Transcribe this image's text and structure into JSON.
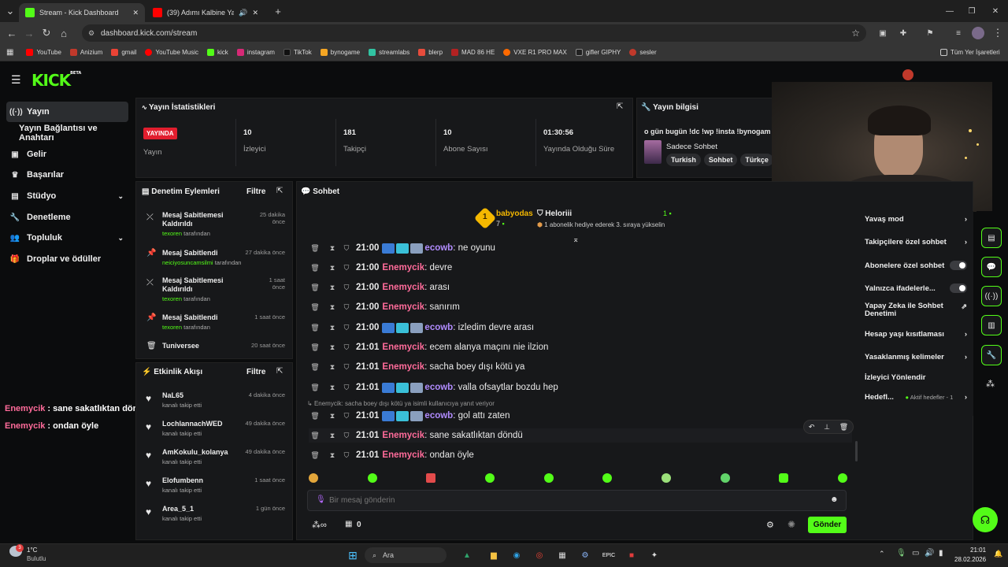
{
  "browser": {
    "tabs": [
      {
        "title": "Stream - Kick Dashboard",
        "active": true
      },
      {
        "title": "(39) Adımı Kalbine Yaz - You",
        "active": false
      }
    ],
    "url": "dashboard.kick.com/stream",
    "bookmarks": [
      "YouTube",
      "Anizium",
      "gmail",
      "YouTube Music",
      "kick",
      "instagram",
      "TikTok",
      "bynogame",
      "streamlabs",
      "blerp",
      "MAD 86 HE",
      "VXE R1 PRO MAX",
      "gifler GIPHY",
      "sesler"
    ],
    "all_bookmarks": "Tüm Yer İşaretleri"
  },
  "kick": {
    "logo": "KICK",
    "logo_sup": "BETA"
  },
  "sidebar": {
    "items": [
      {
        "label": "Yayın",
        "icon": "broadcast-icon",
        "active": true
      },
      {
        "label": "Yayın Bağlantısı ve Anahtarı",
        "icon": "",
        "active": false
      },
      {
        "label": "Gelir",
        "icon": "money-icon",
        "active": false
      },
      {
        "label": "Başarılar",
        "icon": "trophy-icon",
        "active": false
      },
      {
        "label": "Stüdyo",
        "icon": "studio-icon",
        "active": false
      },
      {
        "label": "Denetleme",
        "icon": "wrench-icon",
        "active": false
      },
      {
        "label": "Topluluk",
        "icon": "people-icon",
        "active": false
      },
      {
        "label": "Droplar ve ödüller",
        "icon": "gift-icon",
        "active": false
      }
    ]
  },
  "overlay_chat": [
    {
      "user": "Enemycik",
      "text": " : sane sakatlıktan döndü"
    },
    {
      "user": "Enemycik",
      "text": " : ondan öyle"
    }
  ],
  "stats": {
    "title": "Yayın İstatistikleri",
    "live_badge": "YAYINDA",
    "items": [
      {
        "value": "",
        "label": "Yayın"
      },
      {
        "value": "10",
        "label": "İzleyici"
      },
      {
        "value": "181",
        "label": "Takipçi"
      },
      {
        "value": "10",
        "label": "Abone Sayısı"
      },
      {
        "value": "01:30:56",
        "label": "Yayında Olduğu Süre"
      }
    ]
  },
  "stream_info": {
    "title": "Yayın bilgisi",
    "stream_title": "o gün bugün !dc !wp !insta !bynogam",
    "category": "Sadece Sohbet",
    "tags": [
      "Turkish",
      "Sohbet",
      "Türkçe"
    ]
  },
  "mod_actions": {
    "title": "Denetim Eylemleri",
    "filter": "Filtre",
    "by_suffix": "tarafından",
    "items": [
      {
        "action": "Mesaj Sabitlemesi Kaldırıldı",
        "by": "texoren",
        "time": "25 dakika önce",
        "icon": "unpin-icon"
      },
      {
        "action": "Mesaj Sabitlendi",
        "by": "neiciyosuncamsilmi",
        "time": "27 dakika önce",
        "icon": "pin-icon"
      },
      {
        "action": "Mesaj Sabitlemesi Kaldırıldı",
        "by": "texoren",
        "time": "1 saat önce",
        "icon": "unpin-icon"
      },
      {
        "action": "Mesaj Sabitlendi",
        "by": "texoren",
        "time": "1 saat önce",
        "icon": "pin-icon"
      },
      {
        "action": "Tuniversee",
        "by": "",
        "time": "20 saat önce",
        "icon": "trash-icon"
      }
    ]
  },
  "activity": {
    "title": "Etkinlik Akışı",
    "filter": "Filtre",
    "items": [
      {
        "name": "NaL65",
        "desc": "kanalı takip etti",
        "time": "4 dakika önce"
      },
      {
        "name": "LochlannachWED",
        "desc": "kanalı takip etti",
        "time": "49 dakika önce"
      },
      {
        "name": "AmKokulu_kolanya",
        "desc": "kanalı takip etti",
        "time": "49 dakika önce"
      },
      {
        "name": "Elofumbenn",
        "desc": "kanalı takip etti",
        "time": "1 saat önce"
      },
      {
        "name": "Area_5_1",
        "desc": "kanalı takip etti",
        "time": "1 gün önce"
      }
    ]
  },
  "chat": {
    "title": "Sohbet",
    "top_gifter": {
      "name": "babyodas",
      "rank": "1",
      "count": "7"
    },
    "sub_user": {
      "name": "Heloriii",
      "count": "1",
      "desc": "1 abonelik hediye ederek 3. sıraya yükselin"
    },
    "messages": [
      {
        "time": "21:00",
        "user": "ecowb",
        "text": "ne oyunu",
        "badges": true
      },
      {
        "time": "21:00",
        "user": "Enemycik",
        "text": "devre",
        "badges": false
      },
      {
        "time": "21:00",
        "user": "Enemycik",
        "text": "arası",
        "badges": false
      },
      {
        "time": "21:00",
        "user": "Enemycik",
        "text": "sanırım",
        "badges": false
      },
      {
        "time": "21:00",
        "user": "ecowb",
        "text": "izledim devre arası",
        "badges": true
      },
      {
        "time": "21:01",
        "user": "Enemycik",
        "text": "ecem alanya maçını nie ilzion",
        "badges": false
      },
      {
        "time": "21:01",
        "user": "Enemycik",
        "text": "sacha boey dışı kötü ya",
        "badges": false
      },
      {
        "time": "21:01",
        "user": "ecowb",
        "text": "valla ofsaytlar bozdu hep",
        "badges": true
      },
      {
        "time": "21:01",
        "user": "ecowb",
        "text": "gol attı zaten",
        "badges": true
      },
      {
        "time": "21:01",
        "user": "Enemycik",
        "text": "sane sakatlıktan döndü",
        "badges": false
      },
      {
        "time": "21:01",
        "user": "Enemycik",
        "text": "ondan öyle",
        "badges": false
      }
    ],
    "reply_note": "Enemycik: sacha boey dışı kötü ya isimli kullanıcıya yanıt veriyor",
    "input_placeholder": "Bir mesaj gönderin",
    "points": "0",
    "send": "Gönder"
  },
  "chat_settings": [
    {
      "label": "Yavaş mod",
      "type": "arrow"
    },
    {
      "label": "Takipçilere özel sohbet",
      "type": "arrow"
    },
    {
      "label": "Abonelere özel sohbet",
      "type": "toggle"
    },
    {
      "label": "Yalnızca ifadelerle...",
      "type": "toggle"
    },
    {
      "label": "Yapay Zeka ile Sohbet Denetimi",
      "type": "external"
    },
    {
      "label": "Hesap yaşı kısıtlaması",
      "type": "arrow"
    },
    {
      "label": "Yasaklanmış kelimeler",
      "type": "arrow"
    },
    {
      "label": "İzleyici Yönlendir",
      "type": "none"
    },
    {
      "label": "Hedefl...",
      "type": "arrow",
      "extra": "Aktif hedefler - 1"
    }
  ],
  "taskbar": {
    "weather_temp": "1°C",
    "weather_desc": "Bulutlu",
    "search": "Ara",
    "time": "21:01",
    "date": "28.02.2026",
    "weather_badge": "3"
  }
}
